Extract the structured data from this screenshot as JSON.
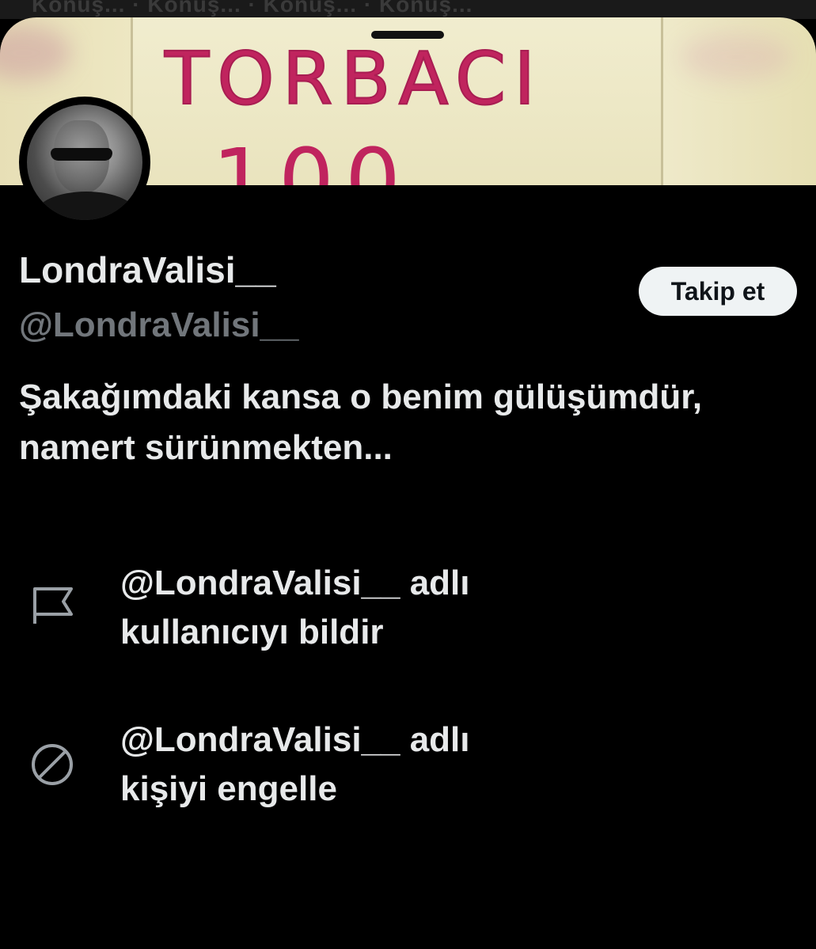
{
  "background": {
    "ghost_text": "Konuş... · Konuş... · Konuş... · Konuş..."
  },
  "banner": {
    "sign_text_top": "TORBACI",
    "sign_text_bottom": "100"
  },
  "profile": {
    "display_name": "LondraValisi__",
    "handle": "@LondraValisi__",
    "bio": "Şakağımdaki kansa o benim gülüşümdür, namert sürünmekten..."
  },
  "actions": {
    "follow_label": "Takip et"
  },
  "menu": {
    "items": [
      {
        "label_line1": "@LondraValisi__ adlı",
        "label_line2": "kullanıcıyı bildir",
        "icon": "flag-icon"
      },
      {
        "label_line1": "@LondraValisi__ adlı",
        "label_line2": "kişiyi engelle",
        "icon": "block-icon"
      }
    ]
  },
  "colors": {
    "background": "#000000",
    "primary_text": "#e7e9ea",
    "secondary_text": "#71767b",
    "button_bg": "#eff3f4",
    "button_text": "#0f1419",
    "sign_ink": "#c0245e"
  }
}
